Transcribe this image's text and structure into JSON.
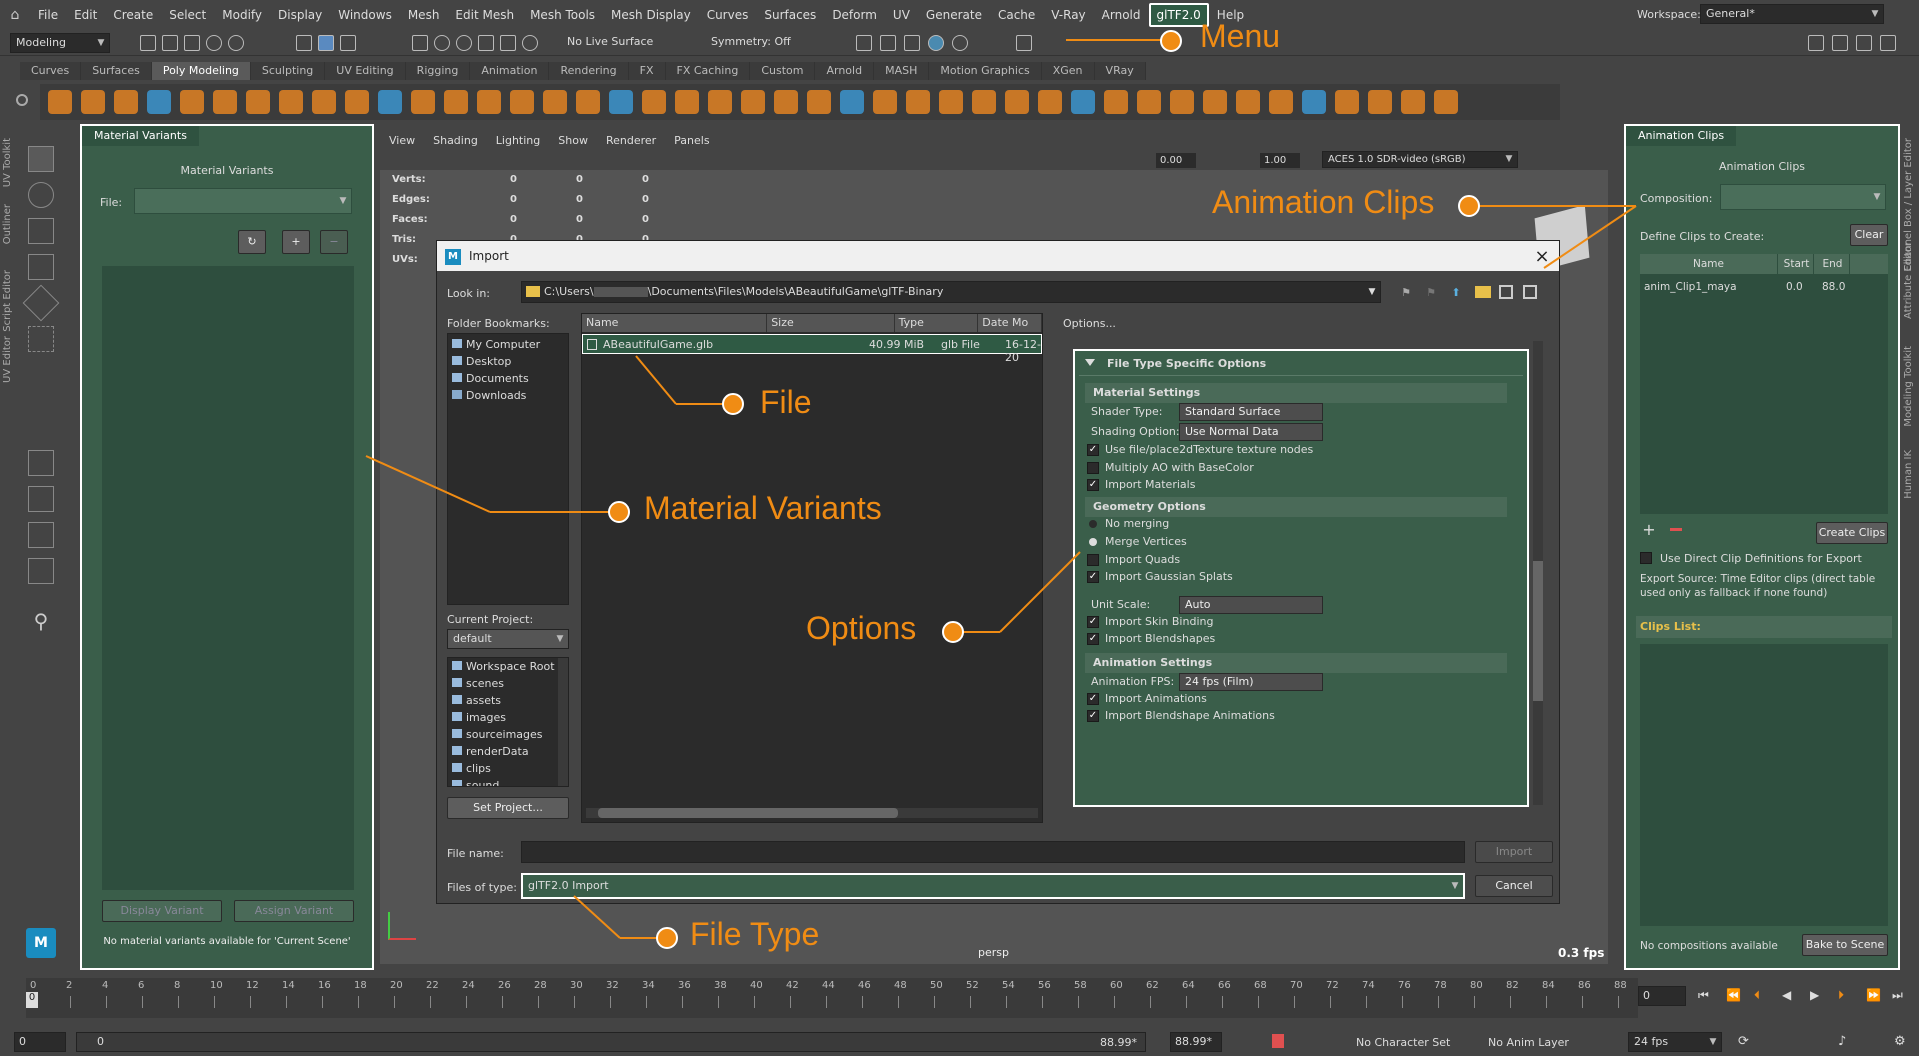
{
  "menu": [
    "File",
    "Edit",
    "Create",
    "Select",
    "Modify",
    "Display",
    "Windows",
    "Mesh",
    "Edit Mesh",
    "Mesh Tools",
    "Mesh Display",
    "Curves",
    "Surfaces",
    "Deform",
    "UV",
    "Generate",
    "Cache",
    "V-Ray",
    "Arnold",
    "glTF2.0",
    "Help"
  ],
  "workspace": {
    "label": "Workspace:",
    "value": "General*"
  },
  "status": {
    "mode": "Modeling",
    "live": "No Live Surface",
    "symmetry": "Symmetry: Off"
  },
  "shelf_tabs": [
    "Curves",
    "Surfaces",
    "Poly Modeling",
    "Sculpting",
    "UV Editing",
    "Rigging",
    "Animation",
    "Rendering",
    "FX",
    "FX Caching",
    "Custom",
    "Arnold",
    "MASH",
    "Motion Graphics",
    "XGen",
    "VRay"
  ],
  "left_side_tabs": [
    "UV Toolkit",
    "Outliner",
    "Script Editor",
    "UV Editor"
  ],
  "right_side_tabs": [
    "Channel Box / Layer Editor",
    "Attribute Editor",
    "Modeling Toolkit",
    "Human IK"
  ],
  "material_variants": {
    "tab": "Material Variants",
    "title": "Material Variants",
    "file_label": "File:",
    "display_btn": "Display Variant",
    "assign_btn": "Assign Variant",
    "status": "No material variants available for 'Current Scene'"
  },
  "viewport": {
    "menus": [
      "View",
      "Shading",
      "Lighting",
      "Show",
      "Renderer",
      "Panels"
    ],
    "hud": [
      {
        "label": "Verts:",
        "v": [
          "0",
          "0",
          "0"
        ]
      },
      {
        "label": "Edges:",
        "v": [
          "0",
          "0",
          "0"
        ]
      },
      {
        "label": "Faces:",
        "v": [
          "0",
          "0",
          "0"
        ]
      },
      {
        "label": "Tris:",
        "v": [
          "0",
          "0",
          "0"
        ]
      },
      {
        "label": "UVs:",
        "v": [
          "0",
          "0",
          "0"
        ]
      }
    ],
    "exposure": "0.00",
    "gamma": "1.00",
    "colorspace": "ACES 1.0 SDR-video (sRGB)",
    "camera": "persp",
    "fps": "0.3 fps"
  },
  "import_dialog": {
    "title": "Import",
    "look_in_label": "Look in:",
    "path_a": "C:\\Users\\",
    "path_b": "\\Documents\\Files\\Models\\ABeautifulGame\\glTF-Binary",
    "bookmarks_label": "Folder Bookmarks:",
    "bookmarks": [
      "My Computer",
      "Desktop",
      "Documents",
      "Downloads"
    ],
    "current_project_label": "Current Project:",
    "project": "default",
    "project_dirs": [
      "Workspace Root",
      "scenes",
      "assets",
      "images",
      "sourceimages",
      "renderData",
      "clips",
      "sound"
    ],
    "set_project": "Set Project...",
    "columns": [
      "Name",
      "Size",
      "Type",
      "Date Mo"
    ],
    "file": {
      "name": "ABeautifulGame.glb",
      "size": "40.99 MiB",
      "type": "glb File",
      "date": "16-12-20"
    },
    "options_label": "Options...",
    "file_name_label": "File name:",
    "files_of_type_label": "Files of type:",
    "file_type": "glTF2.0 Import",
    "import_btn": "Import",
    "cancel_btn": "Cancel"
  },
  "options": {
    "header": "File Type Specific Options",
    "material_settings": "Material Settings",
    "shader_type_label": "Shader Type:",
    "shader_type": "Standard Surface",
    "shading_option_label": "Shading Option:",
    "shading_option": "Use Normal Data",
    "use_file_nodes": "Use file/place2dTexture texture nodes",
    "multiply_ao": "Multiply AO with BaseColor",
    "import_materials": "Import Materials",
    "geometry_options": "Geometry Options",
    "no_merging": "No merging",
    "merge_vertices": "Merge Vertices",
    "import_quads": "Import Quads",
    "import_gaussian": "Import Gaussian Splats",
    "unit_scale_label": "Unit Scale:",
    "unit_scale": "Auto",
    "import_skin": "Import Skin Binding",
    "import_blendshapes": "Import Blendshapes",
    "animation_settings": "Animation Settings",
    "anim_fps_label": "Animation FPS:",
    "anim_fps": "24 fps (Film)",
    "import_animations": "Import Animations",
    "import_bs_anims": "Import Blendshape Animations"
  },
  "animation_clips": {
    "tab": "Animation Clips",
    "title": "Animation Clips",
    "composition_label": "Composition:",
    "define_label": "Define Clips to Create:",
    "clear_btn": "Clear",
    "columns": [
      "Name",
      "Start",
      "End"
    ],
    "rows": [
      {
        "name": "anim_Clip1_maya",
        "start": "0.0",
        "end": "88.0"
      }
    ],
    "create_btn": "Create Clips",
    "use_direct": "Use Direct Clip Definitions for Export",
    "export_source": "Export Source: Time Editor clips (direct table used only as fallback if none found)",
    "clips_list": "Clips List:",
    "no_comp": "No compositions available",
    "bake_btn": "Bake to Scene"
  },
  "timeline": {
    "ticks": [
      "0",
      "2",
      "4",
      "6",
      "8",
      "10",
      "12",
      "14",
      "16",
      "18",
      "20",
      "22",
      "24",
      "26",
      "28",
      "30",
      "32",
      "34",
      "36",
      "38",
      "40",
      "42",
      "44",
      "46",
      "48",
      "50",
      "52",
      "54",
      "56",
      "58",
      "60",
      "62",
      "64",
      "66",
      "68",
      "70",
      "72",
      "74",
      "76",
      "78",
      "80",
      "82",
      "84",
      "86",
      "88"
    ],
    "current_frame": "0",
    "start_frame": "0",
    "start2": "0",
    "range_end": "88.99*",
    "range_end2": "88.99*",
    "char_set": "No Character Set",
    "anim_layer": "No Anim Layer",
    "fps": "24 fps",
    "frame_field": "0"
  },
  "annotations": {
    "menu": "Menu",
    "animation_clips": "Animation Clips",
    "file": "File",
    "material_variants": "Material Variants",
    "options": "Options",
    "file_type": "File Type"
  },
  "colors": {
    "accent": "#f08c14",
    "panel_green": "#3a5e4a",
    "highlight": "#2f5a44"
  }
}
